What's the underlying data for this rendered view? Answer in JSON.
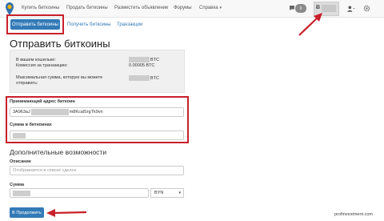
{
  "nav": {
    "links": [
      "Купить биткоины",
      "Продать биткоины",
      "Разместить объявление",
      "Форумы",
      "Справка"
    ],
    "messages_count": "0",
    "balance_symbol": "Ƀ"
  },
  "tabs": {
    "active": "Отправить биткоины",
    "receive": "Получить биткоины",
    "transactions": "Транзакции"
  },
  "title": "Отправить биткоины",
  "info": {
    "wallet_label": "В вашем кошельке:",
    "wallet_unit": "BTC",
    "fee_label": "Комиссия за транзакцию:",
    "fee_value": "0.00005 BTC",
    "max_label_1": "Максимальная сумма, которую вы можете",
    "max_label_2": "отправить:",
    "max_unit": "BTC"
  },
  "address": {
    "label": "Принимающий адрес биткоин",
    "value_start": "3A963aJ",
    "value_end": "m8KcalSrgTk9vn"
  },
  "amount_btc": {
    "label": "Сумма в биткоинах"
  },
  "extra": {
    "heading": "Дополнительные возможности",
    "description_label": "Описание",
    "description_placeholder": "Отображается в списке сделок",
    "amount_label": "Сумма",
    "currency": "BYN"
  },
  "continue_button": "Ƀ Продолжить",
  "watermark": "profinvestment.com",
  "colors": {
    "primary": "#337ab7",
    "highlight": "#c8202a"
  }
}
